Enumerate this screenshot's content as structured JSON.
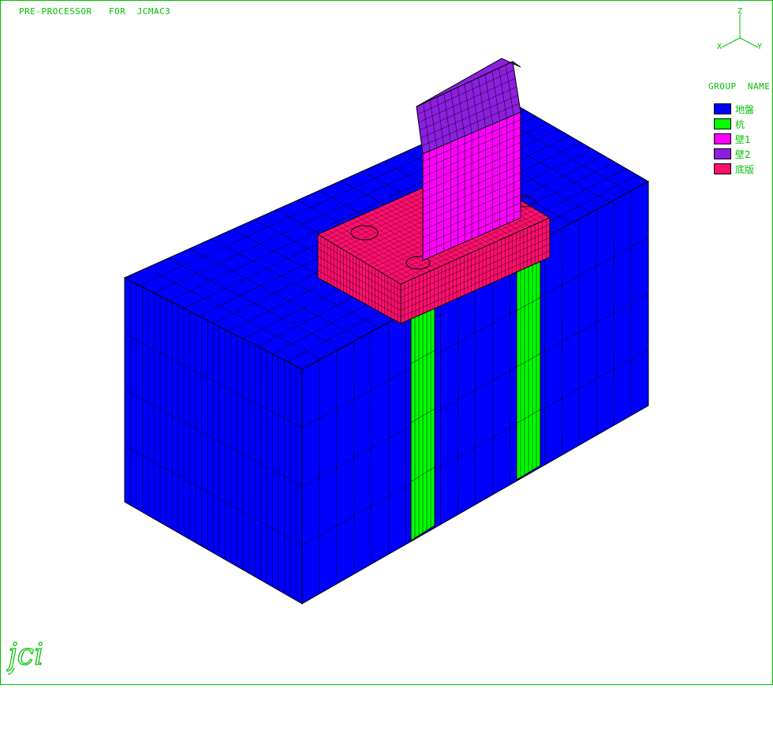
{
  "header": {
    "title": "PRE-PROCESSOR   FOR  JCMAC3"
  },
  "axes": {
    "z": "Z",
    "x": "X",
    "y": "Y"
  },
  "legend": {
    "title": "GROUP  NAME",
    "items": [
      {
        "label": "地盤",
        "color": "#0000ff"
      },
      {
        "label": "杭",
        "color": "#00ff00"
      },
      {
        "label": "壁1",
        "color": "#ff00ff"
      },
      {
        "label": "壁2",
        "color": "#8c1fe0"
      },
      {
        "label": "底版",
        "color": "#ff0f6e"
      }
    ]
  },
  "logo": {
    "text": "jci"
  },
  "colors": {
    "frame": "#00c000",
    "text": "#00c000",
    "mesh_line": "#000000"
  }
}
